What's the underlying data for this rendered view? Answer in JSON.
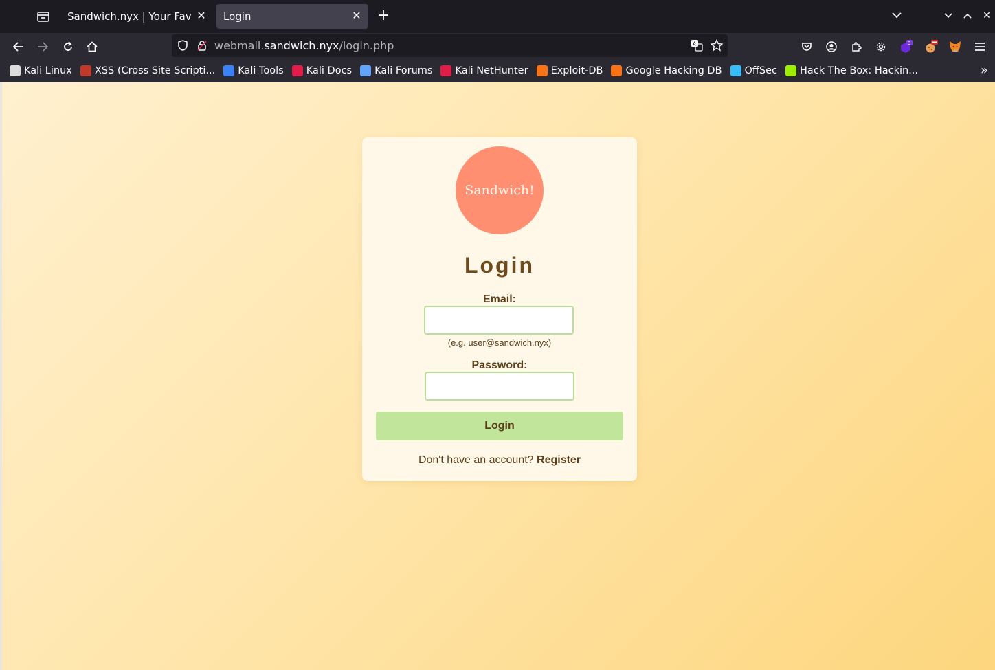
{
  "browser": {
    "tabs": [
      {
        "title": "Sandwich.nyx | Your Favorite Sandwich Shop",
        "active": false
      },
      {
        "title": "Login",
        "active": true
      }
    ],
    "url": {
      "prefix": "webmail.",
      "host": "sandwich.nyx",
      "path": "/login.php"
    },
    "extension_badge": "3",
    "bookmarks": [
      {
        "label": "Kali Linux",
        "icon": "kali-dragon-icon",
        "color": "#dcdcdc"
      },
      {
        "label": "XSS (Cross Site Scripti...",
        "icon": "xss-icon",
        "color": "#c0392b"
      },
      {
        "label": "Kali Tools",
        "icon": "kali-tools-icon",
        "color": "#3b82f6"
      },
      {
        "label": "Kali Docs",
        "icon": "kali-docs-icon",
        "color": "#e11d48"
      },
      {
        "label": "Kali Forums",
        "icon": "kali-forums-icon",
        "color": "#60a5fa"
      },
      {
        "label": "Kali NetHunter",
        "icon": "kali-nethunter-icon",
        "color": "#e11d48"
      },
      {
        "label": "Exploit-DB",
        "icon": "exploit-db-icon",
        "color": "#f97316"
      },
      {
        "label": "Google Hacking DB",
        "icon": "ghdb-icon",
        "color": "#f97316"
      },
      {
        "label": "OffSec",
        "icon": "offsec-icon",
        "color": "#38bdf8"
      },
      {
        "label": "Hack The Box: Hackin...",
        "icon": "htb-icon",
        "color": "#9fef00"
      }
    ]
  },
  "login": {
    "logo_text": "Sandwich!",
    "title": "Login",
    "email_label": "Email:",
    "email_value": "",
    "email_hint": "(e.g. user@sandwich.nyx)",
    "password_label": "Password:",
    "password_value": "",
    "submit_label": "Login",
    "register_prompt": "Don't have an account?",
    "register_link": "Register"
  },
  "colors": {
    "logo": "#ff8f70",
    "button": "#c0e59b",
    "text": "#5a3f1a",
    "card": "#fff7e8"
  }
}
